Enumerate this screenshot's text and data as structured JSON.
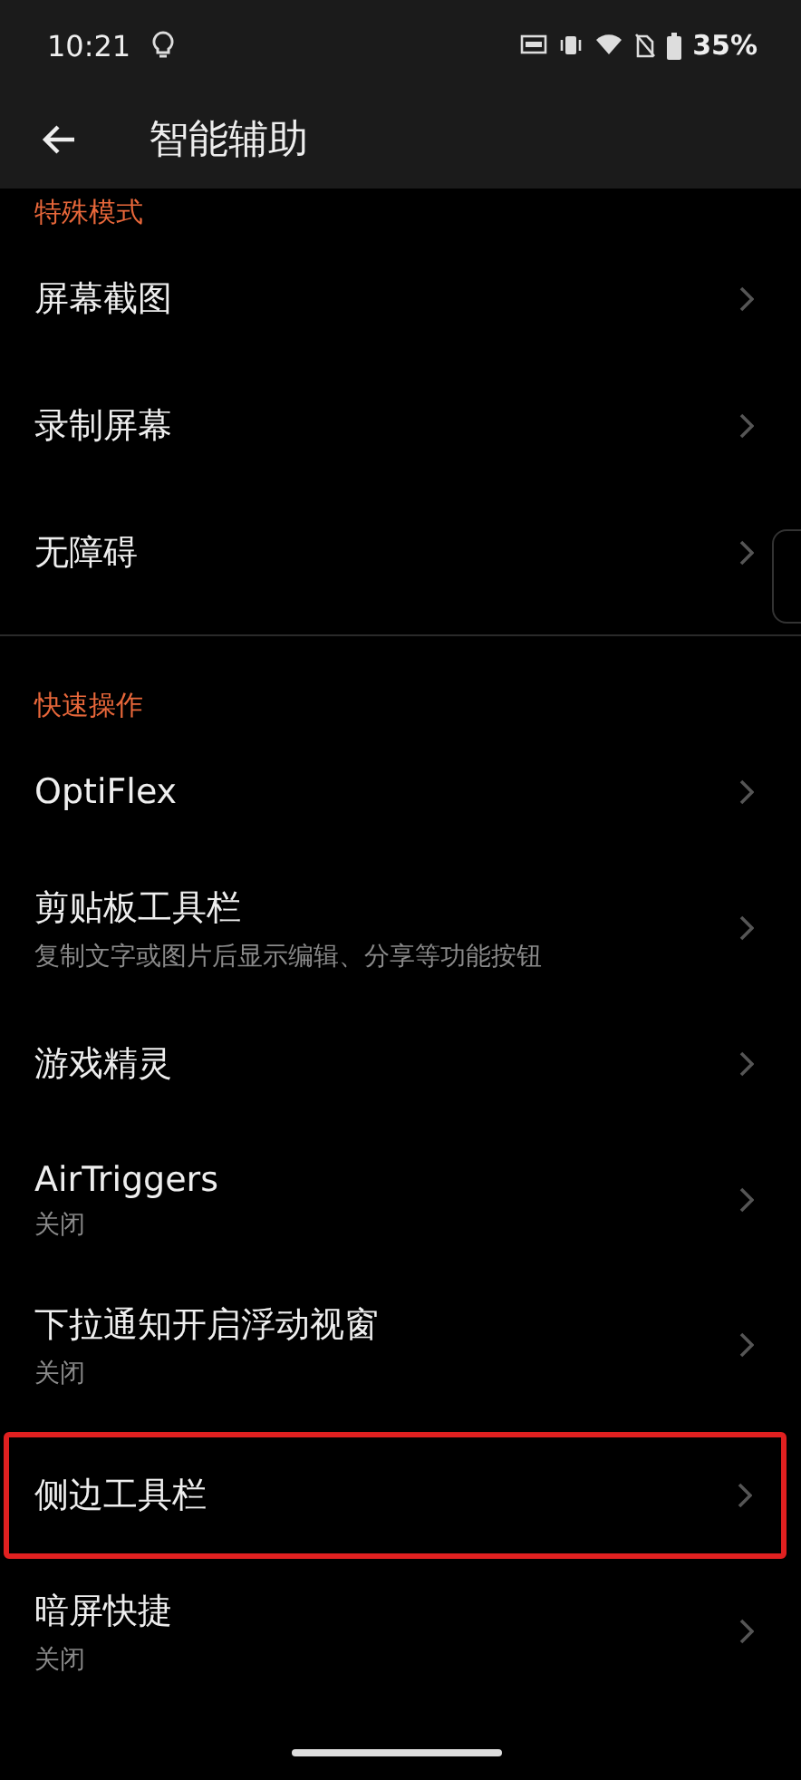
{
  "status_bar": {
    "time": "10:21",
    "battery": "35%"
  },
  "app_bar": {
    "title": "智能辅助"
  },
  "sections": [
    {
      "header": "特殊模式",
      "items": [
        {
          "title": "屏幕截图",
          "highlighted": false
        },
        {
          "title": "录制屏幕",
          "highlighted": false
        },
        {
          "title": "无障碍",
          "highlighted": false
        }
      ]
    },
    {
      "header": "快速操作",
      "items": [
        {
          "title": "OptiFlex",
          "highlighted": false
        },
        {
          "title": "剪贴板工具栏",
          "subtitle": "复制文字或图片后显示编辑、分享等功能按钮",
          "highlighted": false
        },
        {
          "title": "游戏精灵",
          "highlighted": false
        },
        {
          "title": "AirTriggers",
          "subtitle": "关闭",
          "highlighted": false
        },
        {
          "title": "下拉通知开启浮动视窗",
          "subtitle": "关闭",
          "highlighted": false
        },
        {
          "title": "侧边工具栏",
          "highlighted": true
        },
        {
          "title": "暗屏快捷",
          "subtitle": "关闭",
          "highlighted": false
        }
      ]
    }
  ]
}
